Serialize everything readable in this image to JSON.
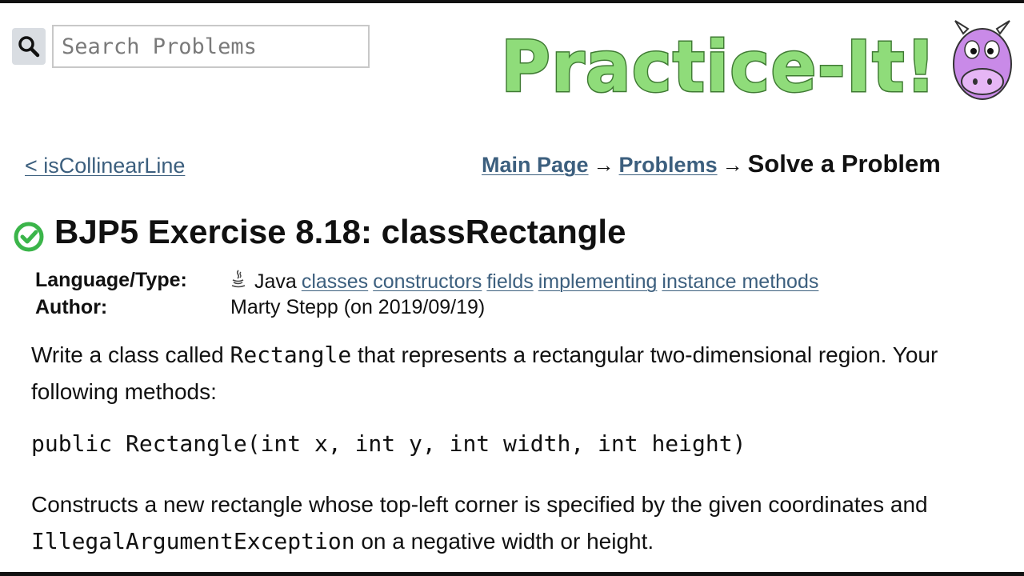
{
  "search": {
    "placeholder": "Search Problems",
    "value": ""
  },
  "logo": {
    "text": "Practice-It!"
  },
  "nav": {
    "prev_label": "< isCollinearLine"
  },
  "breadcrumb": {
    "main": "Main Page",
    "sep1": "→",
    "problems": "Problems",
    "sep2": "→",
    "current": "Solve a Problem"
  },
  "problem": {
    "title": "BJP5 Exercise 8.18: classRectangle",
    "language_label": "Language/Type:",
    "language": "Java",
    "tags": [
      "classes",
      "constructors",
      "fields",
      "implementing",
      "instance methods"
    ],
    "author_label": "Author:",
    "author": "Marty Stepp (on 2019/09/19)"
  },
  "description": {
    "p1_a": "Write a class called ",
    "p1_code": "Rectangle",
    "p1_b": " that represents a rectangular two-dimensional region. Your",
    "p1_line2": "following methods:",
    "signature": "public Rectangle(int x, int y, int width, int height)",
    "p2_line1": "Constructs a new rectangle whose top-left corner is specified by the given coordinates and",
    "p2_code": "IllegalArgumentException",
    "p2_b": " on a negative width or height."
  },
  "colors": {
    "link": "#3c5f7e",
    "logo_green": "#8fdc7a",
    "check_green": "#3bb54a",
    "cow_purple": "#c98ae8"
  }
}
